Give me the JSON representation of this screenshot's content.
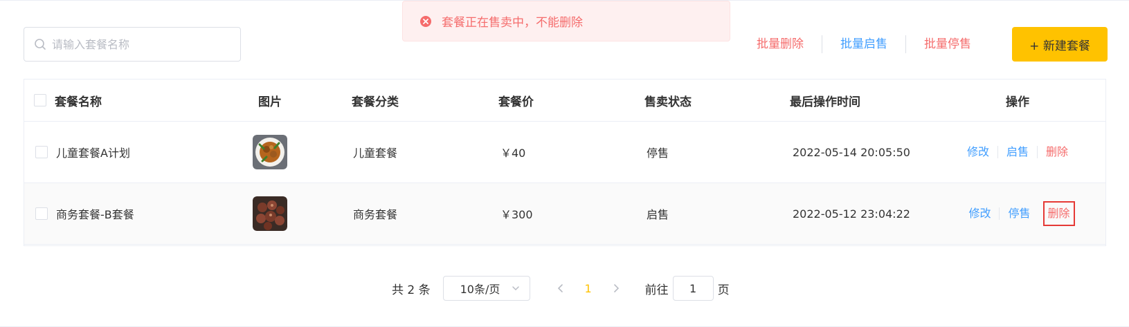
{
  "toast": {
    "message": "套餐正在售卖中，不能删除"
  },
  "search": {
    "placeholder": "请输入套餐名称"
  },
  "batch": {
    "delete_label": "批量删除",
    "enable_label": "批量启售",
    "disable_label": "批量停售"
  },
  "new_button": {
    "label": "+ 新建套餐"
  },
  "table": {
    "columns": [
      "套餐名称",
      "图片",
      "套餐分类",
      "套餐价",
      "售卖状态",
      "最后操作时间",
      "操作"
    ],
    "rows": [
      {
        "name": "儿童套餐A计划",
        "category": "儿童套餐",
        "price": "￥40",
        "status": "停售",
        "updated_at": "2022-05-14 20:05:50",
        "op_edit": "修改",
        "op_toggle": "启售",
        "op_delete": "删除"
      },
      {
        "name": "商务套餐-B套餐",
        "category": "商务套餐",
        "price": "￥300",
        "status": "启售",
        "updated_at": "2022-05-12 23:04:22",
        "op_edit": "修改",
        "op_toggle": "停售",
        "op_delete": "删除"
      }
    ]
  },
  "pagination": {
    "total": "共 2 条",
    "page_size": "10条/页",
    "current_page": "1",
    "goto_label": "前往",
    "goto_value": "1",
    "goto_unit": "页"
  },
  "colors": {
    "accent": "#ffc200",
    "danger": "#f56c6c",
    "link": "#419eff",
    "toast_bg": "#fef0f0"
  }
}
